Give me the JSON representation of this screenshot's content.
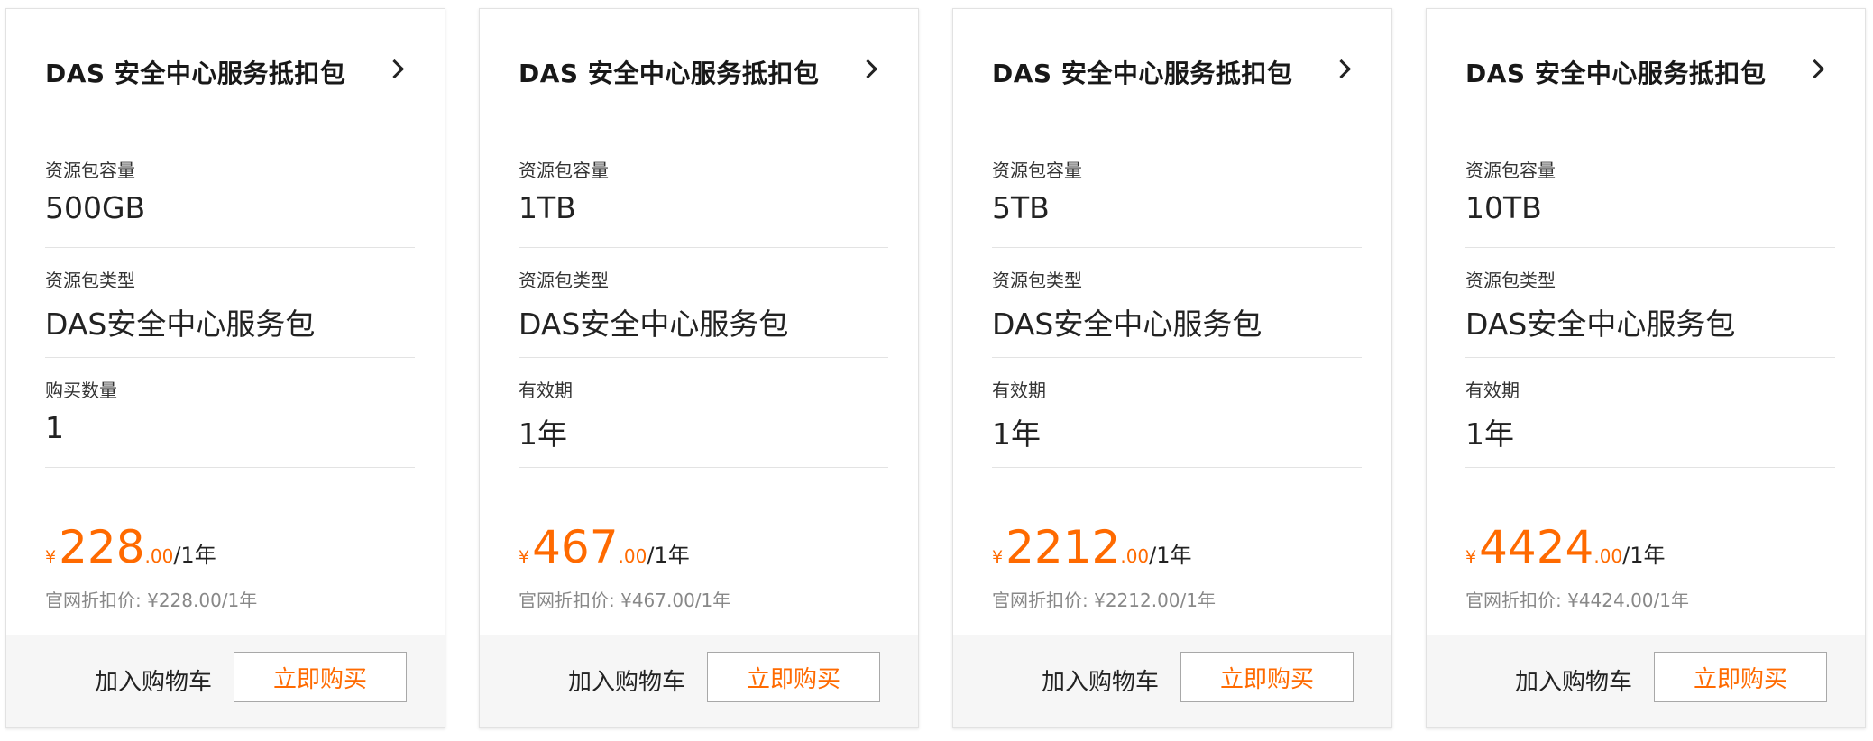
{
  "colors": {
    "accent": "#ff6a00",
    "text": "#222222",
    "muted": "#888888",
    "footer_bg": "#f6f6f6",
    "border": "#e3e3e3"
  },
  "icons": {
    "card_link": "chevron-right-icon"
  },
  "cards": [
    {
      "title": "DAS 安全中心服务抵扣包",
      "fields": [
        {
          "label": "资源包容量",
          "value": "500GB"
        },
        {
          "label": "资源包类型",
          "value": "DAS安全中心服务包"
        },
        {
          "label": "购买数量",
          "value": "1"
        }
      ],
      "price": {
        "currency": "¥",
        "amount": "228",
        "cents": ".00",
        "unit": "/1年"
      },
      "original_price": "官网折扣价: ¥228.00/1年",
      "add_to_cart_label": "加入购物车",
      "buy_now_label": "立即购买"
    },
    {
      "title": "DAS 安全中心服务抵扣包",
      "fields": [
        {
          "label": "资源包容量",
          "value": "1TB"
        },
        {
          "label": "资源包类型",
          "value": "DAS安全中心服务包"
        },
        {
          "label": "有效期",
          "value": "1年"
        }
      ],
      "price": {
        "currency": "¥",
        "amount": "467",
        "cents": ".00",
        "unit": "/1年"
      },
      "original_price": "官网折扣价: ¥467.00/1年",
      "add_to_cart_label": "加入购物车",
      "buy_now_label": "立即购买"
    },
    {
      "title": "DAS 安全中心服务抵扣包",
      "fields": [
        {
          "label": "资源包容量",
          "value": "5TB"
        },
        {
          "label": "资源包类型",
          "value": "DAS安全中心服务包"
        },
        {
          "label": "有效期",
          "value": "1年"
        }
      ],
      "price": {
        "currency": "¥",
        "amount": "2212",
        "cents": ".00",
        "unit": "/1年"
      },
      "original_price": "官网折扣价: ¥2212.00/1年",
      "add_to_cart_label": "加入购物车",
      "buy_now_label": "立即购买"
    },
    {
      "title": "DAS 安全中心服务抵扣包",
      "fields": [
        {
          "label": "资源包容量",
          "value": "10TB"
        },
        {
          "label": "资源包类型",
          "value": "DAS安全中心服务包"
        },
        {
          "label": "有效期",
          "value": "1年"
        }
      ],
      "price": {
        "currency": "¥",
        "amount": "4424",
        "cents": ".00",
        "unit": "/1年"
      },
      "original_price": "官网折扣价: ¥4424.00/1年",
      "add_to_cart_label": "加入购物车",
      "buy_now_label": "立即购买"
    }
  ]
}
